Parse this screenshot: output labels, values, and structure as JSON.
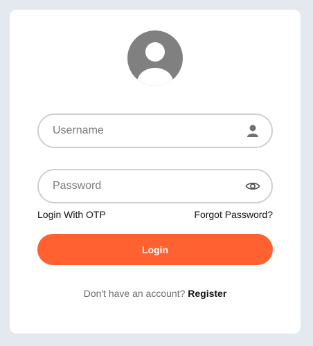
{
  "form": {
    "username_placeholder": "Username",
    "password_placeholder": "Password",
    "login_otp_label": "Login With OTP",
    "forgot_password_label": "Forgot Password?",
    "login_button_label": "Login",
    "register_prompt": "Don't have an account?",
    "register_link_label": "Register"
  },
  "icons": {
    "avatar": "user-avatar-icon",
    "username": "user-icon",
    "password": "eye-icon"
  },
  "colors": {
    "accent": "#ff6130",
    "avatar_bg": "#808080",
    "page_bg": "#e4e8ef",
    "field_border": "#cfcfcf"
  }
}
